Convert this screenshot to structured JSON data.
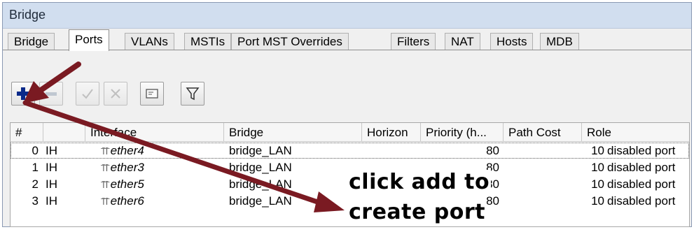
{
  "window": {
    "title": "Bridge"
  },
  "tabs": [
    {
      "label": "Bridge"
    },
    {
      "label": "Ports"
    },
    {
      "label": "VLANs"
    },
    {
      "label": "MSTIs"
    },
    {
      "label": "Port MST Overrides"
    },
    {
      "label": "Filters"
    },
    {
      "label": "NAT"
    },
    {
      "label": "Hosts"
    },
    {
      "label": "MDB"
    }
  ],
  "active_tab": "Ports",
  "toolbar": [
    {
      "icon": "plus-icon",
      "enabled": true
    },
    {
      "icon": "minus-icon",
      "enabled": false
    },
    {
      "icon": "check-icon",
      "enabled": false
    },
    {
      "icon": "cross-icon",
      "enabled": false
    },
    {
      "icon": "comment-icon",
      "enabled": true
    },
    {
      "icon": "filter-icon",
      "enabled": true
    }
  ],
  "table": {
    "columns": [
      "#",
      "",
      "Interface",
      "Bridge",
      "Horizon",
      "Priority (h...",
      "Path Cost",
      "Role"
    ],
    "rows": [
      {
        "num": "0",
        "flags": "IH",
        "interface": "ether4",
        "bridge": "bridge_LAN",
        "horizon": "",
        "priority": "80",
        "path_cost": "10",
        "role": "disabled port"
      },
      {
        "num": "1",
        "flags": "IH",
        "interface": "ether3",
        "bridge": "bridge_LAN",
        "horizon": "",
        "priority": "80",
        "path_cost": "10",
        "role": "disabled port"
      },
      {
        "num": "2",
        "flags": "IH",
        "interface": "ether5",
        "bridge": "bridge_LAN",
        "horizon": "",
        "priority": "80",
        "path_cost": "10",
        "role": "disabled port"
      },
      {
        "num": "3",
        "flags": "IH",
        "interface": "ether6",
        "bridge": "bridge_LAN",
        "horizon": "",
        "priority": "80",
        "path_cost": "10",
        "role": "disabled port"
      }
    ]
  },
  "annotation": {
    "line1": "click add to",
    "line2": "create port",
    "arrow_color": "#7a1a22"
  }
}
